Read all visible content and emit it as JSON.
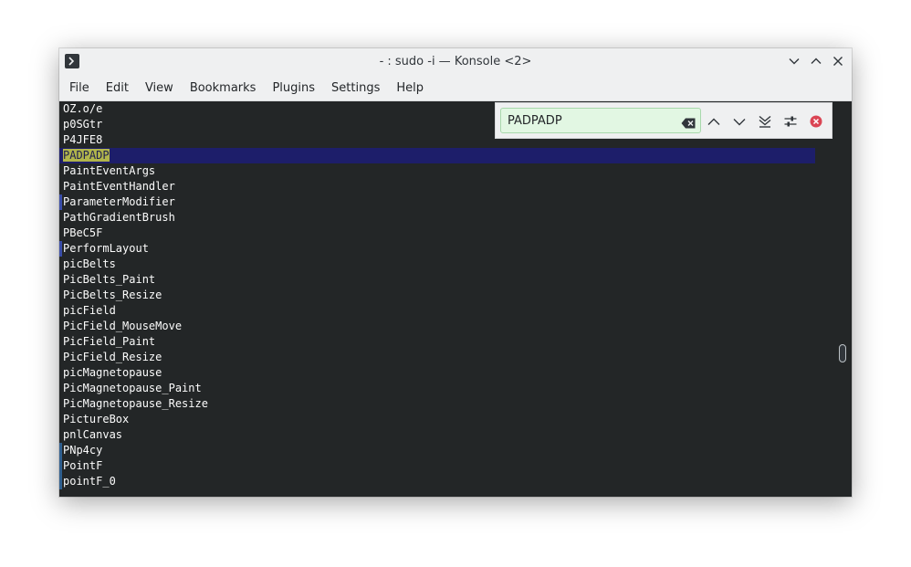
{
  "window": {
    "title": "- : sudo -i — Konsole <2>"
  },
  "menu": {
    "items": [
      "File",
      "Edit",
      "View",
      "Bookmarks",
      "Plugins",
      "Settings",
      "Help"
    ]
  },
  "search": {
    "value": "PADPADP"
  },
  "terminal": {
    "lines": [
      "OZ.o/e",
      "p0SGtr",
      "P4JFE8",
      "PADPADP",
      "PaintEventArgs",
      "PaintEventHandler",
      "ParameterModifier",
      "PathGradientBrush",
      "PBeC5F",
      "PerformLayout",
      "picBelts",
      "PicBelts_Paint",
      "PicBelts_Resize",
      "picField",
      "PicField_MouseMove",
      "PicField_Paint",
      "PicField_Resize",
      "picMagnetopause",
      "PicMagnetopause_Paint",
      "PicMagnetopause_Resize",
      "PictureBox",
      "pnlCanvas",
      "PNp4cy",
      "PointF",
      "pointF_0"
    ]
  },
  "colors": {
    "background": "#232627",
    "text": "#fcfcfc",
    "match_highlight": "#b1b54b",
    "row_highlight": "#1d1e6a",
    "search_field": "#e2f7e3",
    "close_search": "#da4453"
  }
}
